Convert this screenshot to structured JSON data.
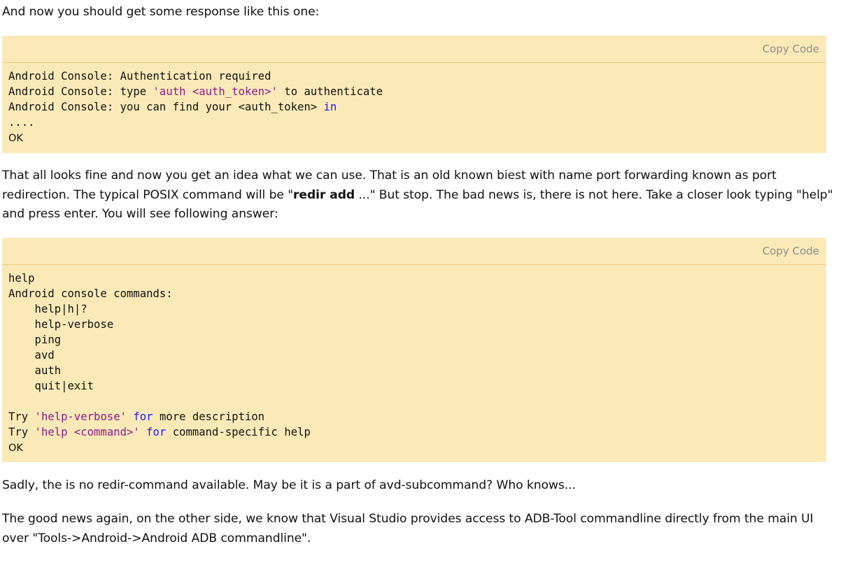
{
  "paragraphs": {
    "intro": "And now you should get some response like this one:",
    "middle_part1": "That all looks fine and now you get an idea what we can use. That is an old known biest with name port forwarding known as port redirection. The typical POSIX command will be \"",
    "middle_bold": "redir add",
    "middle_part2": " ...\" But stop. The bad news is, there is not here. Take a closer look typing \"help\" and press enter. You will see following answer:",
    "sadly": "Sadly, the is no redir-command available. May be it is a part of avd-subcommand? Who knows...",
    "good_news": "The good news again, on the other side, we know that Visual Studio provides access to ADB-Tool commandline directly from the main UI over \"Tools->Android->Android ADB commandline\"."
  },
  "code_block_1": {
    "copy_label": "Copy Code",
    "line1": "Android Console: Authentication required",
    "line2_prefix": "Android Console: type ",
    "line2_string": "'auth <auth_token>'",
    "line2_suffix": " to authenticate",
    "line3_prefix": "Android Console: you can find your <auth_token> ",
    "line3_keyword": "in",
    "line4": "....",
    "line5": "OK"
  },
  "code_block_2": {
    "copy_label": "Copy Code",
    "line1": "help",
    "line2": "Android console commands:",
    "cmd1": "    help|h|?",
    "cmd2": "    help-verbose",
    "cmd3": "    ping",
    "cmd4": "    avd",
    "cmd5": "    auth",
    "cmd6": "    quit|exit",
    "try1_prefix": "Try ",
    "try1_string": "'help-verbose'",
    "try1_keyword": "for",
    "try1_suffix": " more description",
    "try2_prefix": "Try ",
    "try2_string": "'help <command>'",
    "try2_keyword": "for",
    "try2_suffix": " command-specific help",
    "ok": "OK"
  },
  "colors": {
    "code_background": "#fbeab8",
    "code_border": "#f2c979",
    "string": "#8b1a8b",
    "keyword": "#1a1aff",
    "copy_label": "#8d8d8d"
  }
}
